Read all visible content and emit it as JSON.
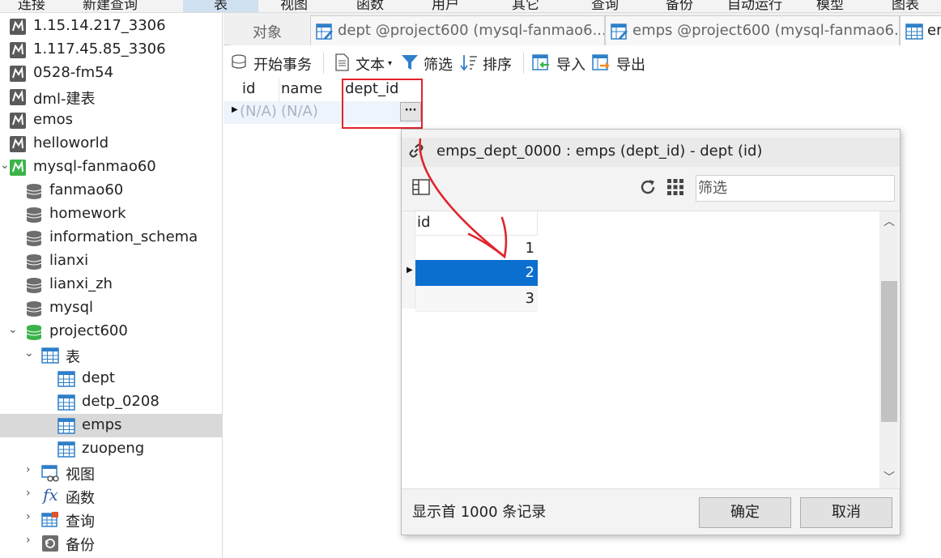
{
  "top_menu": [
    "连接",
    "新建查询",
    "表",
    "视图",
    "函数",
    "用户",
    "其它",
    "查询",
    "备份",
    "自动运行",
    "模型",
    "图表"
  ],
  "sidebar": {
    "connections": [
      {
        "label": "1.15.14.217_3306"
      },
      {
        "label": "1.117.45.85_3306"
      },
      {
        "label": "0528-fm54"
      },
      {
        "label": "dml-建表"
      },
      {
        "label": "emos"
      },
      {
        "label": "helloworld"
      },
      {
        "label": "mysql-fanmao60"
      }
    ],
    "databases": [
      {
        "label": "fanmao60"
      },
      {
        "label": "homework"
      },
      {
        "label": "information_schema"
      },
      {
        "label": "lianxi"
      },
      {
        "label": "lianxi_zh"
      },
      {
        "label": "mysql"
      },
      {
        "label": "project600"
      }
    ],
    "tables_group": "表",
    "tables": [
      {
        "label": "dept"
      },
      {
        "label": "detp_0208"
      },
      {
        "label": "emps"
      },
      {
        "label": "zuopeng"
      }
    ],
    "other_groups": [
      {
        "label": "视图"
      },
      {
        "label": "函数"
      },
      {
        "label": "查询"
      },
      {
        "label": "备份"
      }
    ]
  },
  "tabs": [
    {
      "label": "对象"
    },
    {
      "label": "dept @project600 (mysql-fanmao6..."
    },
    {
      "label": "emps @project600 (mysql-fanmao6..."
    },
    {
      "label": "em"
    }
  ],
  "toolbar": {
    "begin_transaction": "开始事务",
    "text": "文本",
    "filter": "筛选",
    "sort": "排序",
    "import": "导入",
    "export": "导出"
  },
  "grid": {
    "columns": [
      "id",
      "name",
      "dept_id"
    ],
    "row": [
      "(N/A)",
      "(N/A)",
      ""
    ],
    "ellipsis": "···"
  },
  "dialog": {
    "title": "emps_dept_0000 : emps (dept_id) - dept (id)",
    "filter_placeholder": "筛选",
    "list_header": "id",
    "rows": [
      "1",
      "2",
      "3"
    ],
    "selected_index": 1,
    "footer_text": "显示首 1000 条记录",
    "ok_label": "确定",
    "cancel_label": "取消"
  },
  "colors": {
    "selection_blue": "#0b6fd0",
    "annotation_red": "#e0242c",
    "db_green": "#3cb34a",
    "table_blue": "#2f7fc8"
  }
}
